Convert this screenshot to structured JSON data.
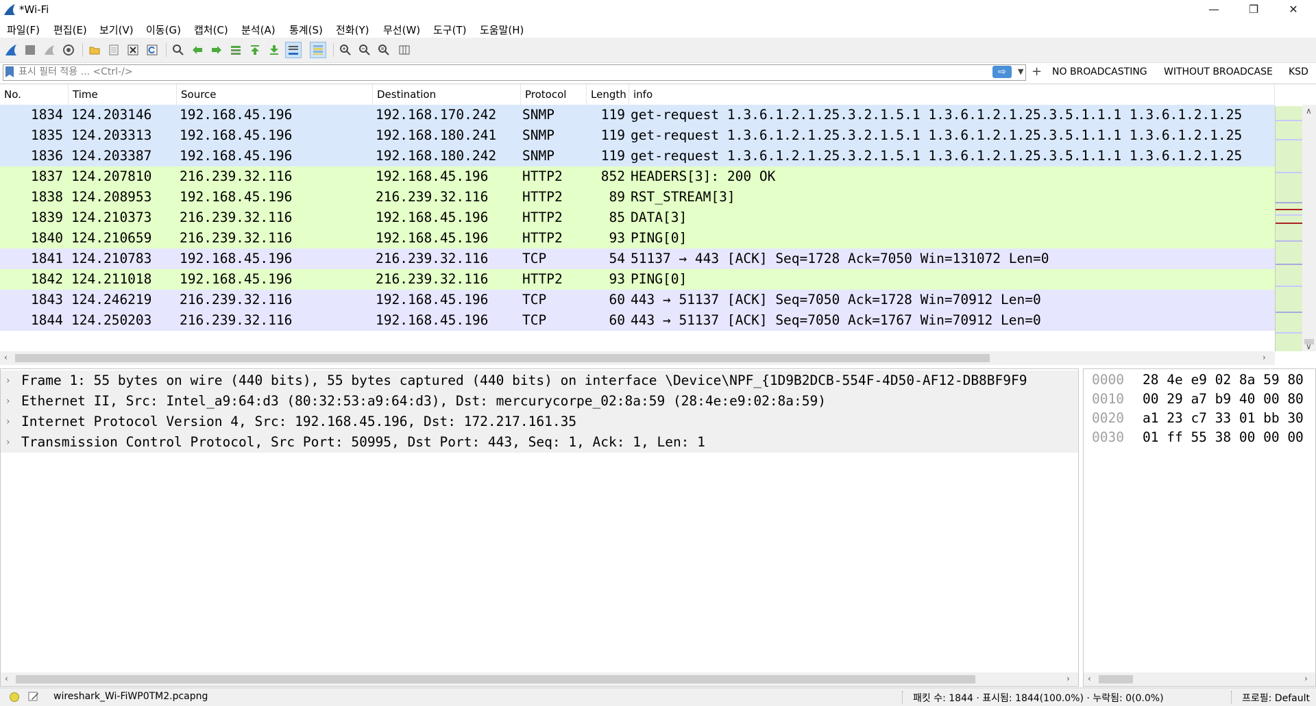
{
  "window": {
    "title": "*Wi-Fi",
    "minimize": "—",
    "restore": "❐",
    "close": "✕"
  },
  "menu": [
    "파일(F)",
    "편집(E)",
    "보기(V)",
    "이동(G)",
    "캡처(C)",
    "분석(A)",
    "통계(S)",
    "전화(Y)",
    "무선(W)",
    "도구(T)",
    "도움말(H)"
  ],
  "filter": {
    "placeholder": "표시 필터 적용 ... <Ctrl-/>",
    "buttons": [
      "NO BROADCASTING",
      "WITHOUT BROADCASE",
      "KSD"
    ]
  },
  "packet_list": {
    "columns": [
      "No.",
      "Time",
      "Source",
      "Destination",
      "Protocol",
      "Length",
      "info"
    ],
    "rows": [
      {
        "no": "1834",
        "time": "124.203146",
        "src": "192.168.45.196",
        "dst": "192.168.170.242",
        "proto": "SNMP",
        "len": "119",
        "info": "get-request 1.3.6.1.2.1.25.3.2.1.5.1 1.3.6.1.2.1.25.3.5.1.1.1 1.3.6.1.2.1.25",
        "bg": "#dae8fc"
      },
      {
        "no": "1835",
        "time": "124.203313",
        "src": "192.168.45.196",
        "dst": "192.168.180.241",
        "proto": "SNMP",
        "len": "119",
        "info": "get-request 1.3.6.1.2.1.25.3.2.1.5.1 1.3.6.1.2.1.25.3.5.1.1.1 1.3.6.1.2.1.25",
        "bg": "#dae8fc"
      },
      {
        "no": "1836",
        "time": "124.203387",
        "src": "192.168.45.196",
        "dst": "192.168.180.242",
        "proto": "SNMP",
        "len": "119",
        "info": "get-request 1.3.6.1.2.1.25.3.2.1.5.1 1.3.6.1.2.1.25.3.5.1.1.1 1.3.6.1.2.1.25",
        "bg": "#dae8fc"
      },
      {
        "no": "1837",
        "time": "124.207810",
        "src": "216.239.32.116",
        "dst": "192.168.45.196",
        "proto": "HTTP2",
        "len": "852",
        "info": "HEADERS[3]: 200 OK",
        "bg": "#e4ffc7"
      },
      {
        "no": "1838",
        "time": "124.208953",
        "src": "192.168.45.196",
        "dst": "216.239.32.116",
        "proto": "HTTP2",
        "len": "89",
        "info": "RST_STREAM[3]",
        "bg": "#e4ffc7"
      },
      {
        "no": "1839",
        "time": "124.210373",
        "src": "216.239.32.116",
        "dst": "192.168.45.196",
        "proto": "HTTP2",
        "len": "85",
        "info": "DATA[3]",
        "bg": "#e4ffc7"
      },
      {
        "no": "1840",
        "time": "124.210659",
        "src": "216.239.32.116",
        "dst": "192.168.45.196",
        "proto": "HTTP2",
        "len": "93",
        "info": "PING[0]",
        "bg": "#e4ffc7"
      },
      {
        "no": "1841",
        "time": "124.210783",
        "src": "192.168.45.196",
        "dst": "216.239.32.116",
        "proto": "TCP",
        "len": "54",
        "info": "51137 → 443 [ACK] Seq=1728 Ack=7050 Win=131072 Len=0",
        "bg": "#e7e6ff"
      },
      {
        "no": "1842",
        "time": "124.211018",
        "src": "192.168.45.196",
        "dst": "216.239.32.116",
        "proto": "HTTP2",
        "len": "93",
        "info": "PING[0]",
        "bg": "#e4ffc7"
      },
      {
        "no": "1843",
        "time": "124.246219",
        "src": "216.239.32.116",
        "dst": "192.168.45.196",
        "proto": "TCP",
        "len": "60",
        "info": "443 → 51137 [ACK] Seq=7050 Ack=1728 Win=70912 Len=0",
        "bg": "#e7e6ff"
      },
      {
        "no": "1844",
        "time": "124.250203",
        "src": "216.239.32.116",
        "dst": "192.168.45.196",
        "proto": "TCP",
        "len": "60",
        "info": "443 → 51137 [ACK] Seq=7050 Ack=1767 Win=70912 Len=0",
        "bg": "#e7e6ff"
      }
    ]
  },
  "details": [
    "Frame 1: 55 bytes on wire (440 bits), 55 bytes captured (440 bits) on interface \\Device\\NPF_{1D9B2DCB-554F-4D50-AF12-DB8BF9F9",
    "Ethernet II, Src: Intel_a9:64:d3 (80:32:53:a9:64:d3), Dst: mercurycorpe_02:8a:59 (28:4e:e9:02:8a:59)",
    "Internet Protocol Version 4, Src: 192.168.45.196, Dst: 172.217.161.35",
    "Transmission Control Protocol, Src Port: 50995, Dst Port: 443, Seq: 1, Ack: 1, Len: 1"
  ],
  "expander_glyph": "›",
  "bytes": [
    {
      "offset": "0000",
      "hex": "28 4e e9 02 8a 59 80"
    },
    {
      "offset": "0010",
      "hex": "00 29 a7 b9 40 00 80"
    },
    {
      "offset": "0020",
      "hex": "a1 23 c7 33 01 bb 30"
    },
    {
      "offset": "0030",
      "hex": "01 ff 55 38 00 00 00"
    }
  ],
  "status": {
    "file": "wireshark_Wi-FiWP0TM2.pcapng",
    "counts": "패킷 수: 1844 · 표시됨: 1844(100.0%) · 누락됨: 0(0.0%)",
    "profile": "프로필: Default"
  },
  "colors": {
    "snmp_row": "#dae8fc",
    "http2_row": "#e4ffc7",
    "tcp_row": "#e7e6ff",
    "accent": "#4a90d9"
  }
}
